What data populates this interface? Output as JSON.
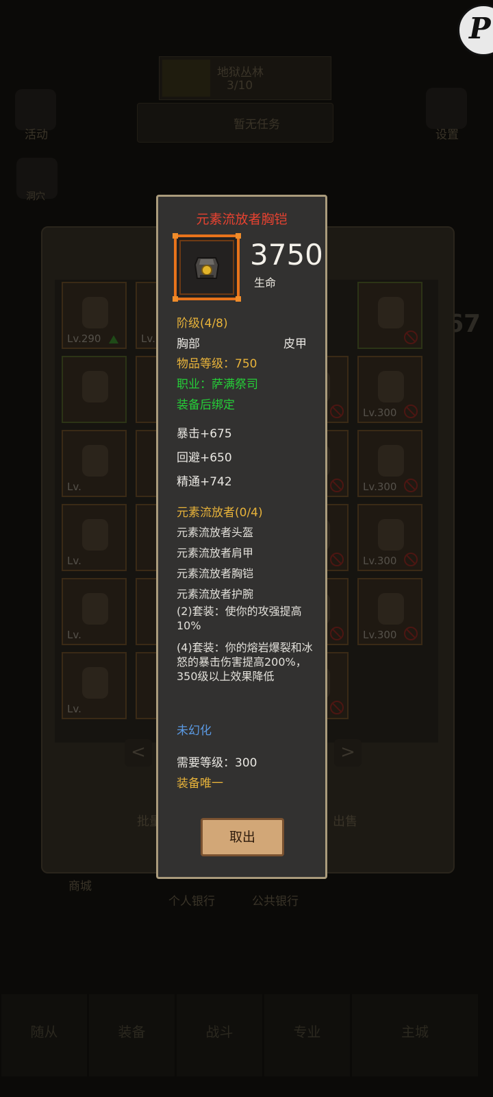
{
  "background": {
    "stage_title": "地狱丛林",
    "stage_progress": "3/10",
    "task_label": "暂无任务",
    "activity_label": "活动",
    "settings_label": "设置",
    "left_icon_label": "洞穴",
    "stat_fragment": "67",
    "batch_label": "批量",
    "sell_label": "出售",
    "shop_label": "商城",
    "personal_bank_label": "个人银行",
    "public_bank_label": "公共银行",
    "tabs": [
      "随从",
      "装备",
      "战斗",
      "专业",
      "主城"
    ],
    "inventory": [
      {
        "lv": "Lv.290",
        "state": "up"
      },
      {
        "lv": "Lv.",
        "state": ""
      },
      {
        "lv": "",
        "state": "ban"
      },
      {
        "lv": "",
        "state": ""
      },
      {
        "lv": "",
        "state": "ban"
      },
      {
        "lv": "Lv.300",
        "state": "ban"
      },
      {
        "lv": "Lv.300",
        "state": "ban"
      },
      {
        "lv": "Lv.",
        "state": ""
      },
      {
        "lv": "",
        "state": "ban"
      },
      {
        "lv": "Lv.300",
        "state": "ban"
      },
      {
        "lv": "Lv.300",
        "state": "ban"
      },
      {
        "lv": "Lv.",
        "state": ""
      },
      {
        "lv": "",
        "state": "ban"
      },
      {
        "lv": "Lv.300",
        "state": "ban"
      },
      {
        "lv": "Lv.300",
        "state": "ban"
      },
      {
        "lv": "Lv.",
        "state": ""
      },
      {
        "lv": "",
        "state": "ban"
      },
      {
        "lv": "Lv.300",
        "state": "ban"
      },
      {
        "lv": "Lv.300",
        "state": "ban"
      },
      {
        "lv": "Lv.",
        "state": ""
      },
      {
        "lv": "",
        "state": "ban"
      },
      {
        "lv": "Lv.300",
        "state": "ban"
      }
    ]
  },
  "tooltip": {
    "title": "元素流放者胸铠",
    "primary_stat_value": "3750",
    "primary_stat_label": "生命",
    "tier": "阶级(4/8)",
    "slot": "胸部",
    "armor_type": "皮甲",
    "item_level": "物品等级：750",
    "class_req": "职业：萨满祭司",
    "bind": "装备后绑定",
    "stats": [
      "暴击+675",
      "回避+650",
      "精通+742"
    ],
    "set_name": "元素流放者(0/4)",
    "set_pieces": [
      "元素流放者头盔",
      "元素流放者肩甲",
      "元素流放者胸铠",
      "元素流放者护腕"
    ],
    "set_bonus_2": "(2)套装：使你的攻强提高10%",
    "set_bonus_4": "(4)套装：你的熔岩爆裂和冰怒的暴击伤害提高200%，350级以上效果降低",
    "transmog": "未幻化",
    "required_level": "需要等级：300",
    "unique": "装备唯一",
    "cancel_label": "取出"
  },
  "colors": {
    "title_red": "#e64230",
    "gold": "#e8b33a",
    "green": "#25cf38",
    "blue": "#5b9ae4",
    "frame_orange": "#e8731b",
    "tooltip_bg": "#323130",
    "tooltip_border": "#aa9b7c"
  }
}
